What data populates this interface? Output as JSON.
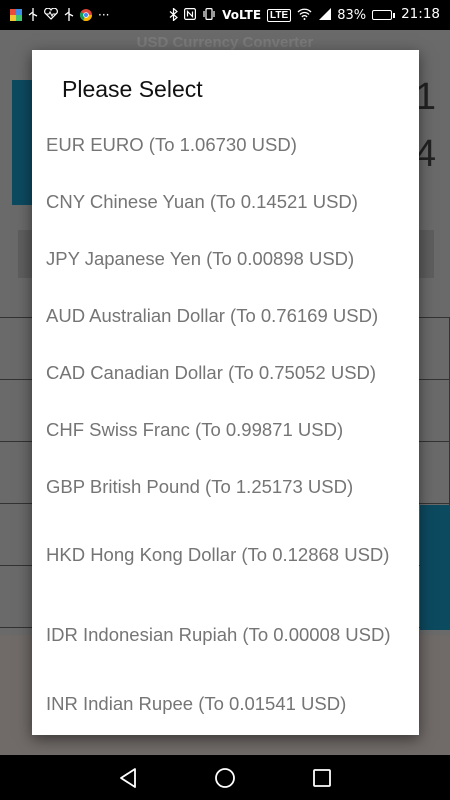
{
  "status_bar": {
    "time": "21:18",
    "battery_percent": "83%",
    "network": "VoLTE",
    "lte_badge": "LTE",
    "left_icons": [
      "photo-icon",
      "usb-icon",
      "heart-rate-icon",
      "usb-icon",
      "chrome-icon",
      "more-icon"
    ],
    "right_icons": [
      "bluetooth-icon",
      "nfc-icon",
      "vibrate-icon",
      "wifi-icon",
      "signal-icon",
      "battery-icon"
    ],
    "battery_level": 0.83,
    "more_glyph": "···"
  },
  "app": {
    "title": "USD Currency Converter",
    "bg_digits": [
      "1",
      "4"
    ]
  },
  "dialog": {
    "title": "Please Select",
    "options": [
      {
        "label": "EUR EURO (To 1.06730 USD)"
      },
      {
        "label": "CNY Chinese Yuan (To 0.14521 USD)"
      },
      {
        "label": "JPY Japanese Yen (To 0.00898 USD)"
      },
      {
        "label": "AUD Australian Dollar (To 0.76169 USD)"
      },
      {
        "label": "CAD Canadian Dollar (To 0.75052 USD)"
      },
      {
        "label": "CHF Swiss Franc (To 0.99871 USD)"
      },
      {
        "label": "GBP British Pound (To 1.25173 USD)"
      },
      {
        "label": "HKD Hong Kong Dollar (To 0.12868 USD)"
      },
      {
        "label": "IDR Indonesian Rupiah (To 0.00008 USD)"
      },
      {
        "label": "INR Indian Rupee (To 0.01541 USD)"
      }
    ]
  },
  "nav_bar": {
    "buttons": [
      "back-icon",
      "home-icon",
      "recents-icon"
    ]
  },
  "colors": {
    "dialog_bg": "#ffffff",
    "option_text": "#757575",
    "title_text": "#111111",
    "scrim": "#3d3d3d",
    "accent": "#0c4a60"
  }
}
